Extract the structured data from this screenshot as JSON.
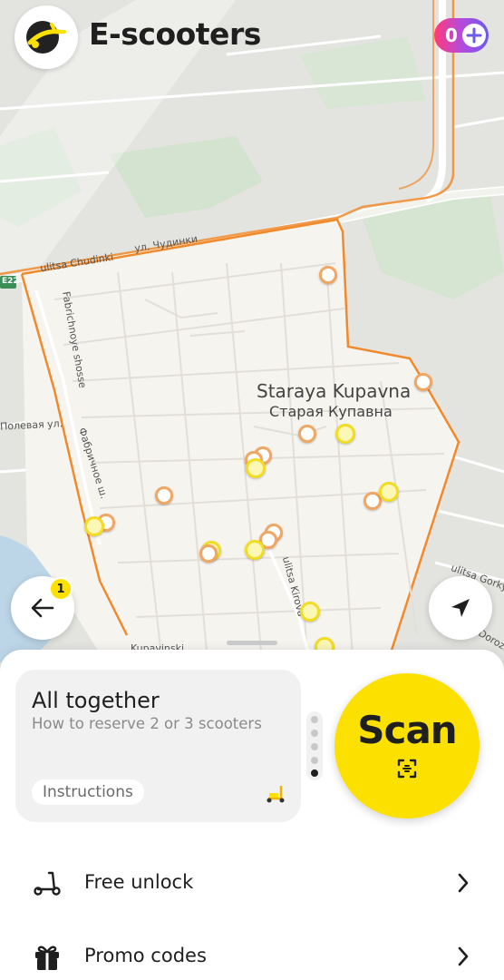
{
  "header": {
    "title": "E-scooters",
    "plus_points": "0",
    "logo_icon": "scooter-logo-icon"
  },
  "map": {
    "place_name": "Staraya Kupavna",
    "place_name_local": "Старая Купавна",
    "road_labels": {
      "chudinki_en": "ulitsa Chudinki",
      "chudinki_ru": "ул. Чудинки",
      "fabrichnoye_en": "Fabrichnoye shosse",
      "fabrichnoye_ru": "Фабричное ш.",
      "polevaya_ru": "Полевая ул.",
      "kirova_en": "ulitsa Kirova",
      "gorky_en": "ulitsa Gorky",
      "dorozh": "Dorozh",
      "kupavinsky": "Kupavinski",
      "highway_code": "E22"
    },
    "notification_count": "1"
  },
  "card": {
    "title": "All together",
    "subtitle": "How to reserve 2 or 3 scooters",
    "button": "Instructions",
    "pager_total": 5,
    "pager_active": 5
  },
  "scan": {
    "label": "Scan",
    "icon": "qr-scan-icon"
  },
  "menu": [
    {
      "label": "Free unlock",
      "icon": "scooter-icon"
    },
    {
      "label": "Promo codes",
      "icon": "gift-icon"
    }
  ],
  "colors": {
    "accent_yellow": "#fce000",
    "zone_border": "#f08a2c",
    "plus_gradient_start": "#ff3a78",
    "plus_gradient_end": "#6b59f2"
  }
}
